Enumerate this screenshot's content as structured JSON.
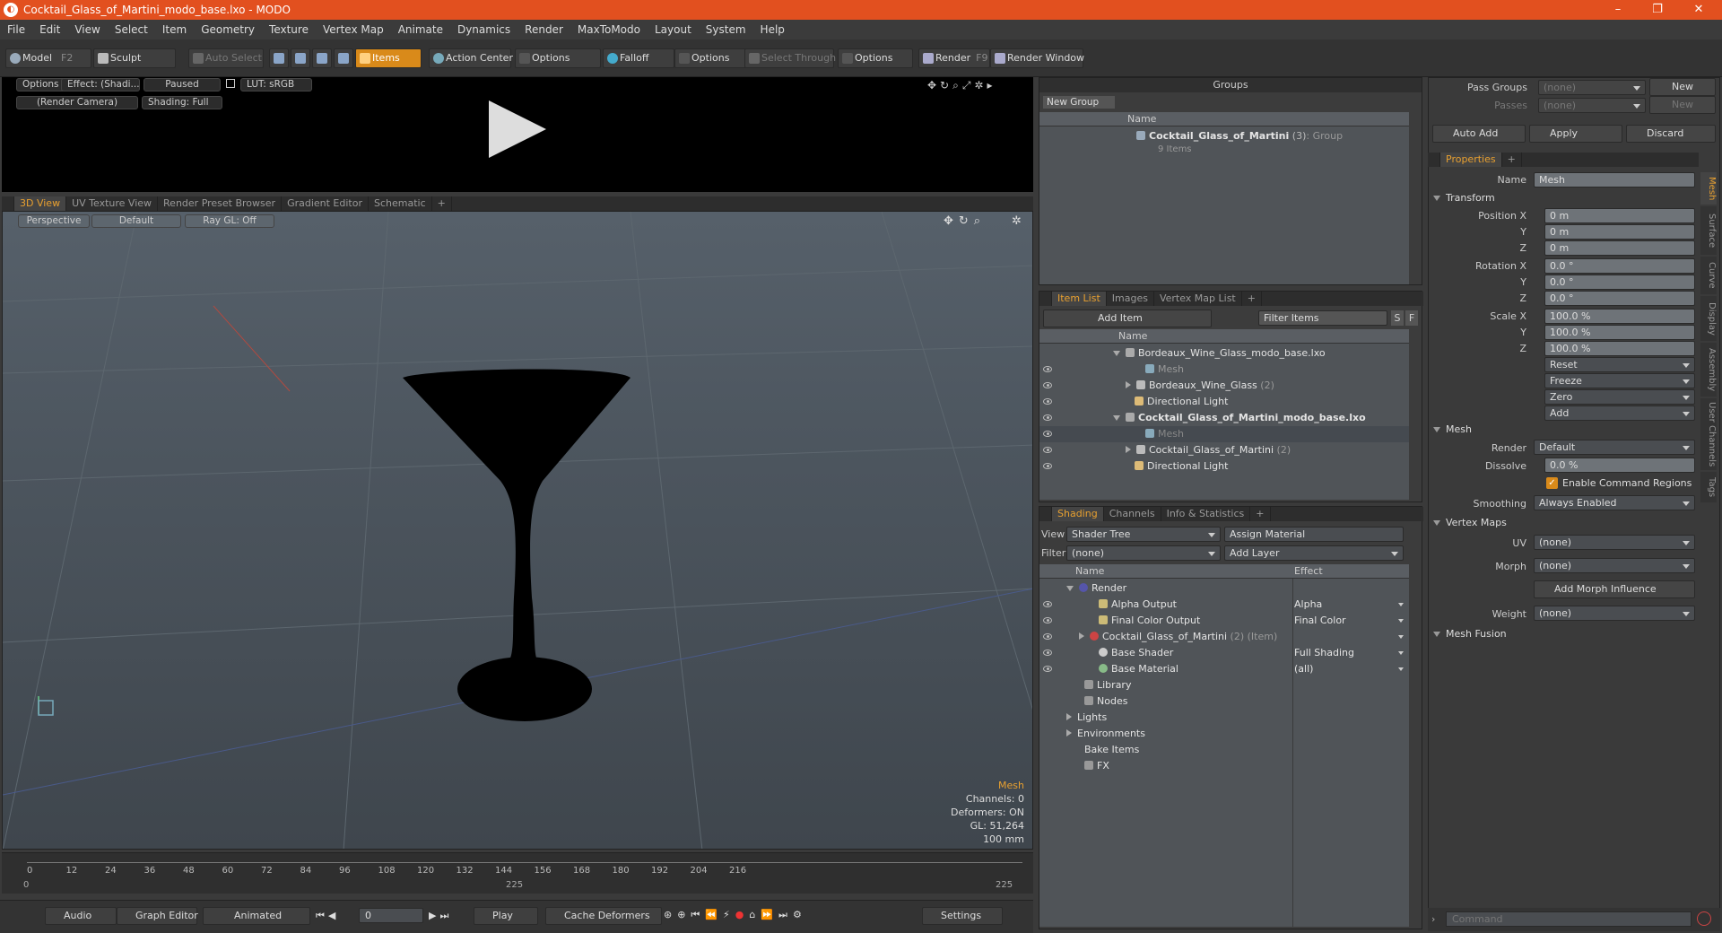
{
  "title": "Cocktail_Glass_of_Martini_modo_base.lxo - MODO",
  "menu": [
    "File",
    "Edit",
    "View",
    "Select",
    "Item",
    "Geometry",
    "Texture",
    "Vertex Map",
    "Animate",
    "Dynamics",
    "Render",
    "MaxToModo",
    "Layout",
    "System",
    "Help"
  ],
  "toolbar": {
    "model": "Model",
    "model_key": "F2",
    "sculpt": "Sculpt",
    "auto_select": "Auto Select",
    "items": "Items",
    "action_center": "Action Center",
    "options": "Options",
    "falloff": "Falloff",
    "select_through": "Select Through",
    "render": "Render",
    "render_key": "F9",
    "render_window": "Render Window"
  },
  "preview": {
    "options": "Options",
    "effect": "Effect: (Shadi...",
    "paused": "Paused",
    "lut": "LUT: sRGB",
    "camera": "(Render Camera)",
    "shading": "Shading: Full"
  },
  "view_tabs": [
    "3D View",
    "UV Texture View",
    "Render Preset Browser",
    "Gradient Editor",
    "Schematic",
    "+"
  ],
  "viewport": {
    "perspective": "Perspective",
    "default": "Default",
    "raygl": "Ray GL: Off",
    "info_title": "Mesh",
    "info_lines": [
      "Channels: 0",
      "Deformers: ON",
      "GL: 51,264",
      "100 mm"
    ]
  },
  "timeline": {
    "ticks": [
      "0",
      "12",
      "24",
      "36",
      "48",
      "60",
      "72",
      "84",
      "96",
      "108",
      "120",
      "132",
      "144",
      "156",
      "168",
      "180",
      "192",
      "204",
      "216"
    ],
    "start": "0",
    "mid": "225",
    "end": "225"
  },
  "bottom": {
    "audio": "Audio",
    "graph_editor": "Graph Editor",
    "animated": "Animated",
    "frame": "0",
    "play": "Play",
    "cache": "Cache Deformers",
    "settings": "Settings"
  },
  "groups": {
    "title": "Groups",
    "new_group": "New Group",
    "col_name": "Name",
    "item_name": "Cocktail_Glass_of_Martini",
    "item_count": "(3)",
    "item_type": ": Group",
    "item_sub": "9 Items"
  },
  "itemlist": {
    "tabs": [
      "Item List",
      "Images",
      "Vertex Map List",
      "+"
    ],
    "add_item": "Add Item",
    "filter": "Filter Items",
    "s": "S",
    "f": "F",
    "col_name": "Name",
    "rows": [
      "Bordeaux_Wine_Glass_modo_base.lxo",
      "Mesh",
      "Bordeaux_Wine_Glass",
      "(2)",
      "Directional Light",
      "Cocktail_Glass_of_Martini_modo_base.lxo",
      "Mesh",
      "Cocktail_Glass_of_Martini",
      "(2)",
      "Directional Light"
    ]
  },
  "shading": {
    "tabs": [
      "Shading",
      "Channels",
      "Info & Statistics",
      "+"
    ],
    "view_label": "View",
    "view_value": "Shader Tree",
    "assign": "Assign Material",
    "filter_label": "Filter",
    "filter_value": "(none)",
    "add_layer": "Add Layer",
    "col_name": "Name",
    "col_effect": "Effect",
    "rows": [
      {
        "name": "Render",
        "effect": ""
      },
      {
        "name": "Alpha Output",
        "effect": "Alpha"
      },
      {
        "name": "Final Color Output",
        "effect": "Final Color"
      },
      {
        "name": "Cocktail_Glass_of_Martini",
        "extra": "(2) (Item)",
        "effect": ""
      },
      {
        "name": "Base Shader",
        "effect": "Full Shading"
      },
      {
        "name": "Base Material",
        "effect": "(all)"
      },
      {
        "name": "Library",
        "effect": ""
      },
      {
        "name": "Nodes",
        "effect": ""
      },
      {
        "name": "Lights",
        "effect": ""
      },
      {
        "name": "Environments",
        "effect": ""
      },
      {
        "name": "Bake Items",
        "effect": ""
      },
      {
        "name": "FX",
        "effect": ""
      }
    ]
  },
  "pass": {
    "pass_groups": "Pass Groups",
    "passes": "Passes",
    "none": "(none)",
    "new": "New",
    "auto_add": "Auto Add",
    "apply": "Apply",
    "discard": "Discard"
  },
  "props": {
    "tab": "Properties",
    "plus": "+",
    "name_label": "Name",
    "name_value": "Mesh",
    "transform": "Transform",
    "pos_x": "Position X",
    "y": "Y",
    "z": "Z",
    "rot_x": "Rotation X",
    "scale_x": "Scale X",
    "pos": [
      "0 m",
      "0 m",
      "0 m"
    ],
    "rot": [
      "0.0 °",
      "0.0 °",
      "0.0 °"
    ],
    "scale": [
      "100.0 %",
      "100.0 %",
      "100.0 %"
    ],
    "reset": "Reset",
    "freeze": "Freeze",
    "zero": "Zero",
    "add": "Add",
    "mesh": "Mesh",
    "render_label": "Render",
    "render_value": "Default",
    "dissolve_label": "Dissolve",
    "dissolve_value": "0.0 %",
    "enable_cmd": "Enable Command Regions",
    "smoothing_label": "Smoothing",
    "smoothing_value": "Always Enabled",
    "vertex_maps": "Vertex Maps",
    "uv_label": "UV",
    "uv_value": "(none)",
    "morph_label": "Morph",
    "morph_value": "(none)",
    "add_morph": "Add Morph Influence",
    "weight_label": "Weight",
    "weight_value": "(none)",
    "mesh_fusion": "Mesh Fusion",
    "side_tabs": [
      "Mesh",
      "Surface",
      "Curve",
      "Display",
      "Assembly",
      "User Channels",
      "Tags"
    ]
  },
  "command": {
    "placeholder": "Command"
  }
}
